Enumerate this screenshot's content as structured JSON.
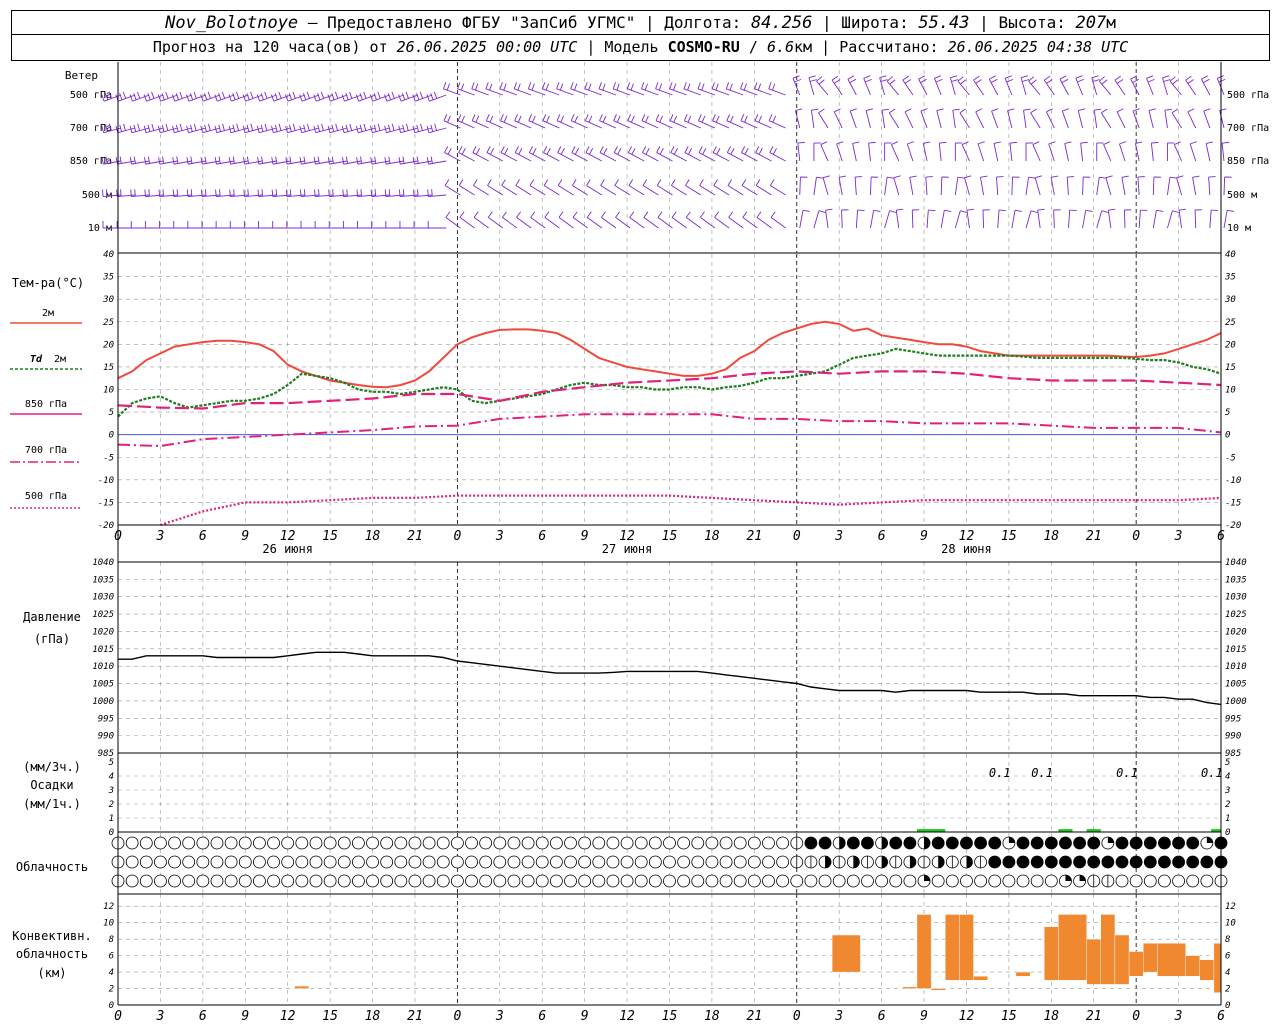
{
  "header": {
    "station": "Nov_Bolotnoye",
    "provider": "Предоставлено ФГБУ \"ЗапСиб УГМС\"",
    "lon_label": "Долгота:",
    "lon_value": "84.256",
    "lat_label": "Широта:",
    "lat_value": "55.43",
    "alt_label": "Высота:",
    "alt_value": "207",
    "alt_unit": "м",
    "forecast_prefix": "Прогноз на 120 часа(ов) от",
    "forecast_time": "26.06.2025 00:00 UTC",
    "model_label": "Модель",
    "model_name": "COSMO-RU",
    "model_res": "6.6",
    "model_res_unit": "км",
    "calc_label": "Рассчитано:",
    "calc_time": "26.06.2025 04:38 UTC"
  },
  "labels": {
    "wind": "Ветер",
    "wind_levels": [
      "500 гПа",
      "700 гПа",
      "850 гПа",
      "500 м",
      "10 м"
    ],
    "temp_title": "Тем-ра(°C)",
    "legend_t2m": "2м",
    "legend_td_a": "Td",
    "legend_td_b": "2м",
    "legend_850": "850 гПа",
    "legend_700": "700 гПа",
    "legend_500": "500 гПа",
    "pressure_a": "Давление",
    "pressure_b": "(гПа)",
    "precip_a": "(мм/3ч.)",
    "precip_b": "Осадки",
    "precip_c": "(мм/1ч.)",
    "cloud": "Облачность",
    "conv_a": "Конвективн.",
    "conv_b": "облачность",
    "conv_c": "(км)"
  },
  "colors": {
    "t2m": "#f04a3c",
    "td": "#1e7d1e",
    "t850": "#e0207a",
    "t700": "#e0207a",
    "t500": "#e0207a",
    "wind": "#7a28d2",
    "pressure": "#000000",
    "precip": "#22c322",
    "conv": "#f08830",
    "zero_line": "#3040e0"
  },
  "chart_data": [
    {
      "type": "line",
      "panel": "temperature",
      "ylim": [
        -20,
        40
      ],
      "yticks": [
        -20,
        -15,
        -10,
        -5,
        0,
        5,
        10,
        15,
        20,
        25,
        30,
        35,
        40
      ],
      "x_hours_start": 0,
      "x_hours_end": 78,
      "x_tick_labels": [
        "0",
        "3",
        "6",
        "9",
        "12",
        "15",
        "18",
        "21",
        "0",
        "3",
        "6",
        "9",
        "12",
        "15",
        "18",
        "21",
        "0",
        "3",
        "6",
        "9",
        "12",
        "15",
        "18",
        "21",
        "0",
        "3",
        "6"
      ],
      "day_labels": [
        "26 июня",
        "27 июня",
        "28 июня"
      ],
      "series": [
        {
          "key": "t2m",
          "x": [
            0,
            1,
            2,
            3,
            4,
            5,
            6,
            7,
            8,
            9,
            10,
            11,
            12,
            13,
            14,
            15,
            16,
            17,
            18,
            19,
            20,
            21,
            22,
            23,
            24,
            25,
            26,
            27,
            28,
            29,
            30,
            31,
            32,
            33,
            34,
            35,
            36,
            37,
            38,
            39,
            40,
            41,
            42,
            43,
            44,
            45,
            46,
            47,
            48,
            49,
            50,
            51,
            52,
            53,
            54,
            55,
            56,
            57,
            58,
            59,
            60,
            61,
            62,
            63,
            64,
            65,
            66,
            67,
            68,
            69,
            70,
            71,
            72,
            73,
            74,
            75,
            76,
            77,
            78
          ],
          "values": [
            12.5,
            14,
            16.5,
            18,
            19.5,
            20,
            20.5,
            20.8,
            20.8,
            20.5,
            20,
            18.5,
            15.5,
            14,
            13,
            12,
            11.5,
            11,
            10.6,
            10.5,
            11,
            12,
            14,
            17,
            20,
            21.5,
            22.5,
            23.2,
            23.3,
            23.3,
            23,
            22.5,
            21,
            19,
            17,
            16,
            15,
            14.5,
            14,
            13.5,
            13,
            13,
            13.5,
            14.5,
            17,
            18.5,
            21,
            22.5,
            23.5,
            24.5,
            25,
            24.5,
            23,
            23.5,
            22,
            21.5,
            21,
            20.5,
            20,
            20,
            19.5,
            18.5,
            18,
            17.5,
            17.5,
            17.5,
            17.5,
            17.5,
            17.5,
            17.5,
            17.5,
            17.3,
            17.2,
            17.5,
            18,
            19,
            20,
            21,
            22.5
          ]
        },
        {
          "key": "td",
          "x": [
            0,
            1,
            2,
            3,
            4,
            5,
            6,
            7,
            8,
            9,
            10,
            11,
            12,
            13,
            14,
            15,
            16,
            17,
            18,
            19,
            20,
            21,
            22,
            23,
            24,
            25,
            26,
            27,
            28,
            29,
            30,
            31,
            32,
            33,
            34,
            35,
            36,
            37,
            38,
            39,
            40,
            41,
            42,
            43,
            44,
            45,
            46,
            47,
            48,
            49,
            50,
            51,
            52,
            53,
            54,
            55,
            56,
            57,
            58,
            59,
            60,
            61,
            62,
            63,
            64,
            65,
            66,
            67,
            68,
            69,
            70,
            71,
            72,
            73,
            74,
            75,
            76,
            77,
            78
          ],
          "values": [
            4,
            7,
            8,
            8.5,
            7,
            6,
            6.5,
            7,
            7.5,
            7.5,
            8,
            9,
            11,
            13.5,
            13,
            12.5,
            11.5,
            10,
            9.5,
            9.5,
            9,
            9.5,
            10,
            10.5,
            10,
            7.5,
            7,
            7.5,
            8,
            8.5,
            9,
            10,
            11,
            11.5,
            11,
            11,
            10.5,
            10.5,
            10,
            10,
            10.5,
            10.5,
            10,
            10.5,
            10.8,
            11.5,
            12.5,
            12.5,
            13,
            13.5,
            14,
            15.5,
            17,
            17.5,
            18,
            19,
            18.5,
            18,
            17.5,
            17.5,
            17.5,
            17.5,
            17.5,
            17.5,
            17.3,
            17,
            17,
            17,
            17,
            17,
            17,
            17,
            16.8,
            16.5,
            16.5,
            16,
            15,
            14.5,
            13.5
          ]
        },
        {
          "key": "t850",
          "x": [
            0,
            3,
            6,
            9,
            12,
            15,
            18,
            21,
            24,
            27,
            30,
            33,
            36,
            39,
            42,
            45,
            48,
            51,
            54,
            57,
            60,
            63,
            66,
            69,
            72,
            75,
            78
          ],
          "values": [
            6.5,
            6,
            5.8,
            7,
            7,
            7.5,
            8,
            9,
            9,
            7.5,
            9.5,
            10.5,
            11.5,
            12,
            12.5,
            13.5,
            14,
            13.5,
            14,
            14,
            13.5,
            12.5,
            12,
            12,
            12,
            11.5,
            11
          ]
        },
        {
          "key": "t700",
          "x": [
            0,
            3,
            6,
            9,
            12,
            15,
            18,
            21,
            24,
            27,
            30,
            33,
            36,
            39,
            42,
            45,
            48,
            51,
            54,
            57,
            60,
            63,
            66,
            69,
            72,
            75,
            78
          ],
          "values": [
            -2.2,
            -2.5,
            -1,
            -0.5,
            0,
            0.5,
            1,
            1.8,
            2,
            3.5,
            4,
            4.5,
            4.5,
            4.5,
            4.5,
            3.5,
            3.5,
            3,
            3,
            2.5,
            2.5,
            2.5,
            2,
            1.5,
            1.5,
            1.5,
            0.5
          ]
        },
        {
          "key": "t500",
          "x": [
            3,
            6,
            9,
            12,
            15,
            18,
            21,
            24,
            27,
            30,
            33,
            36,
            39,
            42,
            45,
            48,
            51,
            54,
            57,
            60,
            63,
            66,
            69,
            72,
            75,
            78
          ],
          "values": [
            -20,
            -17,
            -15,
            -15,
            -14.5,
            -14,
            -14,
            -13.5,
            -13.5,
            -13.5,
            -13.5,
            -13.5,
            -13.5,
            -14,
            -14.5,
            -15,
            -15.5,
            -15,
            -14.5,
            -14.5,
            -14.5,
            -14.5,
            -14.5,
            -14.5,
            -14.5,
            -14
          ]
        }
      ]
    },
    {
      "type": "line",
      "panel": "pressure",
      "ylim": [
        985,
        1040
      ],
      "yticks": [
        985,
        990,
        995,
        1000,
        1005,
        1010,
        1015,
        1020,
        1025,
        1030,
        1035,
        1040
      ],
      "series": [
        {
          "key": "pressure",
          "x": [
            0,
            1,
            2,
            3,
            4,
            5,
            6,
            7,
            8,
            9,
            10,
            11,
            12,
            13,
            14,
            15,
            16,
            17,
            18,
            19,
            20,
            21,
            22,
            23,
            24,
            25,
            26,
            27,
            28,
            29,
            30,
            31,
            32,
            33,
            34,
            35,
            36,
            37,
            38,
            39,
            40,
            41,
            42,
            43,
            44,
            45,
            46,
            47,
            48,
            49,
            50,
            51,
            52,
            53,
            54,
            55,
            56,
            57,
            58,
            59,
            60,
            61,
            62,
            63,
            64,
            65,
            66,
            67,
            68,
            69,
            70,
            71,
            72,
            73,
            74,
            75,
            76,
            77,
            78
          ],
          "values": [
            1012,
            1012,
            1013,
            1013,
            1013,
            1013,
            1013,
            1012.5,
            1012.5,
            1012.5,
            1012.5,
            1012.5,
            1013,
            1013.5,
            1014,
            1014,
            1014,
            1013.5,
            1013,
            1013,
            1013,
            1013,
            1013,
            1012.5,
            1011.5,
            1011,
            1010.5,
            1010,
            1009.5,
            1009,
            1008.5,
            1008,
            1008,
            1008,
            1008,
            1008.2,
            1008.5,
            1008.5,
            1008.5,
            1008.5,
            1008.5,
            1008.5,
            1008,
            1007.5,
            1007,
            1006.5,
            1006,
            1005.5,
            1005,
            1004,
            1003.5,
            1003,
            1003,
            1003,
            1003,
            1002.5,
            1003,
            1003,
            1003,
            1003,
            1003,
            1002.5,
            1002.5,
            1002.5,
            1002.5,
            1002,
            1002,
            1002,
            1001.5,
            1001.5,
            1001.5,
            1001.5,
            1001.5,
            1001,
            1001,
            1000.5,
            1000.5,
            999.5,
            999
          ]
        }
      ]
    },
    {
      "type": "bar",
      "panel": "precipitation",
      "ylim": [
        0,
        5
      ],
      "yticks": [
        0,
        1,
        2,
        3,
        4,
        5
      ],
      "labels": [
        {
          "x": 63,
          "text": "0.1"
        },
        {
          "x": 66,
          "text": "0.1"
        },
        {
          "x": 72,
          "text": "0.1"
        },
        {
          "x": 78,
          "text": "0.1"
        }
      ],
      "bars": [
        {
          "x0": 56.5,
          "x1": 58.5,
          "value": 0.1
        },
        {
          "x0": 66.5,
          "x1": 67.5,
          "value": 0.1
        },
        {
          "x0": 68.5,
          "x1": 69.5,
          "value": 0.1
        },
        {
          "x0": 77.3,
          "x1": 78,
          "value": 0.1
        }
      ]
    },
    {
      "type": "table",
      "panel": "cloudiness",
      "rows": 3,
      "note": "cover per hour: 0=clear,1..3=partial,4=overcast"
    },
    {
      "type": "bar",
      "panel": "convective_cloudiness",
      "ylim": [
        0,
        13
      ],
      "yticks": [
        0,
        2,
        4,
        6,
        8,
        10,
        12
      ],
      "bars": [
        {
          "x0": 12.5,
          "x1": 13.5,
          "bottom": 2,
          "top": 2.3
        },
        {
          "x0": 50.5,
          "x1": 52.5,
          "bottom": 4,
          "top": 8.5
        },
        {
          "x0": 55.5,
          "x1": 56.5,
          "bottom": 2,
          "top": 2.2
        },
        {
          "x0": 56.5,
          "x1": 57.5,
          "bottom": 2,
          "top": 11
        },
        {
          "x0": 57.5,
          "x1": 58.5,
          "bottom": 1.8,
          "top": 2
        },
        {
          "x0": 58.5,
          "x1": 59.5,
          "bottom": 3,
          "top": 11
        },
        {
          "x0": 59.5,
          "x1": 60.5,
          "bottom": 3,
          "top": 11
        },
        {
          "x0": 60.5,
          "x1": 61.5,
          "bottom": 3,
          "top": 3.5
        },
        {
          "x0": 63.5,
          "x1": 64.5,
          "bottom": 3.5,
          "top": 4
        },
        {
          "x0": 65.5,
          "x1": 66.5,
          "bottom": 3,
          "top": 9.5
        },
        {
          "x0": 66.5,
          "x1": 68.5,
          "bottom": 3,
          "top": 11
        },
        {
          "x0": 68.5,
          "x1": 69.5,
          "bottom": 2.5,
          "top": 8
        },
        {
          "x0": 69.5,
          "x1": 70.5,
          "bottom": 2.5,
          "top": 11
        },
        {
          "x0": 70.5,
          "x1": 71.5,
          "bottom": 2.5,
          "top": 8.5
        },
        {
          "x0": 71.5,
          "x1": 72.5,
          "bottom": 3.5,
          "top": 6.5
        },
        {
          "x0": 72.5,
          "x1": 73.5,
          "bottom": 4,
          "top": 7.5
        },
        {
          "x0": 73.5,
          "x1": 75.5,
          "bottom": 3.5,
          "top": 7.5
        },
        {
          "x0": 75.5,
          "x1": 76.5,
          "bottom": 3.5,
          "top": 6
        },
        {
          "x0": 76.5,
          "x1": 77.5,
          "bottom": 3,
          "top": 5.5
        },
        {
          "x0": 77.5,
          "x1": 78,
          "bottom": 1.5,
          "top": 7.5
        }
      ]
    }
  ]
}
